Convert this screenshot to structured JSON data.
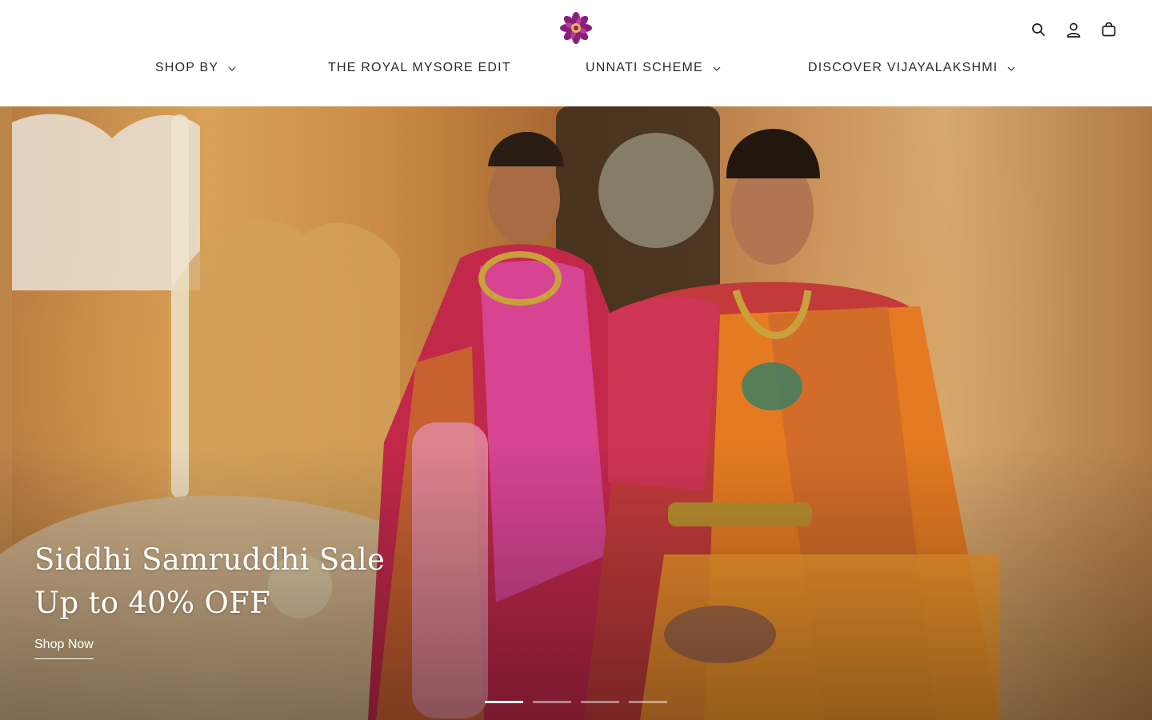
{
  "brand": {
    "logo_icon": "lotus-flower-icon",
    "logo_colors": {
      "primary": "#8a1f7a",
      "accent": "#e7b84a"
    }
  },
  "header_icons": [
    {
      "name": "search-icon"
    },
    {
      "name": "account-icon"
    },
    {
      "name": "cart-icon"
    }
  ],
  "nav": {
    "items": [
      {
        "label": "SHOP BY",
        "has_dropdown": true
      },
      {
        "label": "THE ROYAL MYSORE EDIT",
        "has_dropdown": false
      },
      {
        "label": "UNNATI SCHEME",
        "has_dropdown": true
      },
      {
        "label": "DISCOVER VIJAYALAKSHMI",
        "has_dropdown": true
      }
    ],
    "dropdown_icon": "chevron-down-icon"
  },
  "hero": {
    "title_line1": "Siddhi Samruddhi Sale",
    "title_line2": "Up to 40% OFF",
    "cta_label": "Shop Now",
    "slide_count": 4,
    "active_slide": 1
  },
  "colors": {
    "text": "#2b2b2b",
    "hero_text": "#ffffff"
  }
}
